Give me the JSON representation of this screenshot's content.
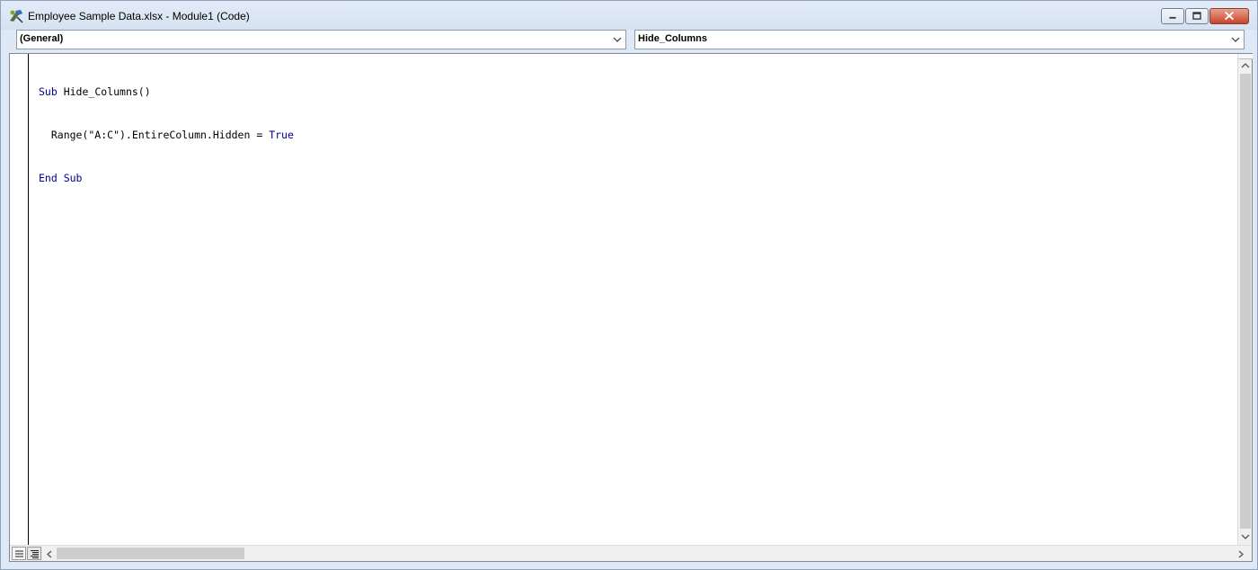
{
  "window": {
    "title": "Employee Sample Data.xlsx - Module1 (Code)",
    "icons": {
      "app": "vba-module-icon",
      "minimize": "minimize-icon",
      "maximize": "maximize-icon",
      "close": "close-icon"
    }
  },
  "object_dropdown": {
    "selected": "(General)"
  },
  "procedure_dropdown": {
    "selected": "Hide_Columns"
  },
  "code": {
    "lines": [
      [
        "Sub",
        " Hide_Columns()"
      ],
      [
        "",
        "  Range(\"A:C\").EntireColumn.Hidden = ",
        "True"
      ],
      [
        "End Sub",
        ""
      ]
    ],
    "line1_kw": "Sub",
    "line1_rest": " Hide_Columns()",
    "line2_rest": "  Range(\"A:C\").EntireColumn.Hidden = ",
    "line2_kw": "True",
    "line3_kw": "End Sub"
  },
  "colors": {
    "keyword": "#00008b",
    "close_button": "#c8432b",
    "title_bar": "#dfe9f5"
  }
}
